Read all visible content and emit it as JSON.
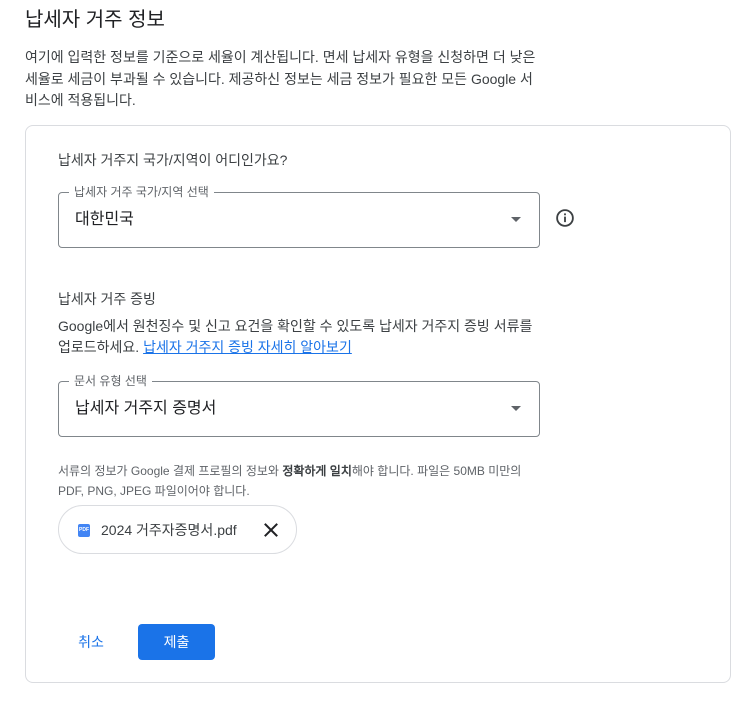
{
  "page": {
    "title": "납세자 거주 정보",
    "description": "여기에 입력한 정보를 기준으로 세율이 계산됩니다. 면세 납세자 유형을 신청하면 더 낮은 세율로 세금이 부과될 수 있습니다. 제공하신 정보는 세금 정보가 필요한 모든 Google 서비스에 적용됩니다."
  },
  "country_section": {
    "question": "납세자 거주지 국가/지역이 어디인가요?",
    "select_label": "납세자 거주 국가/지역 선택",
    "selected_value": "대한민국",
    "info_icon": "info-outline-icon"
  },
  "proof_section": {
    "title": "납세자 거주 증빙",
    "description": "Google에서 원천징수 및 신고 요건을 확인할 수 있도록 납세자 거주지 증빙 서류를 업로드하세요.",
    "learn_more_link": "납세자 거주지 증빙 자세히 알아보기",
    "doc_type_label": "문서 유형 선택",
    "doc_type_value": "납세자 거주지 증명서"
  },
  "file_note": {
    "part1": "서류의 정보가 Google 결제 프로필의 정보와 ",
    "bold": "정확하게 일치",
    "part2": "해야 합니다. 파일은 50MB 미만의 PDF, PNG, JPEG 파일이어야 합니다."
  },
  "uploaded_file": {
    "icon_text": "PDF",
    "name": "2024 거주자증명서.pdf"
  },
  "actions": {
    "cancel": "취소",
    "submit": "제출"
  },
  "colors": {
    "accent": "#1a73e8",
    "border": "#dadce0",
    "text_primary": "#202124",
    "text_secondary": "#5f6368"
  }
}
